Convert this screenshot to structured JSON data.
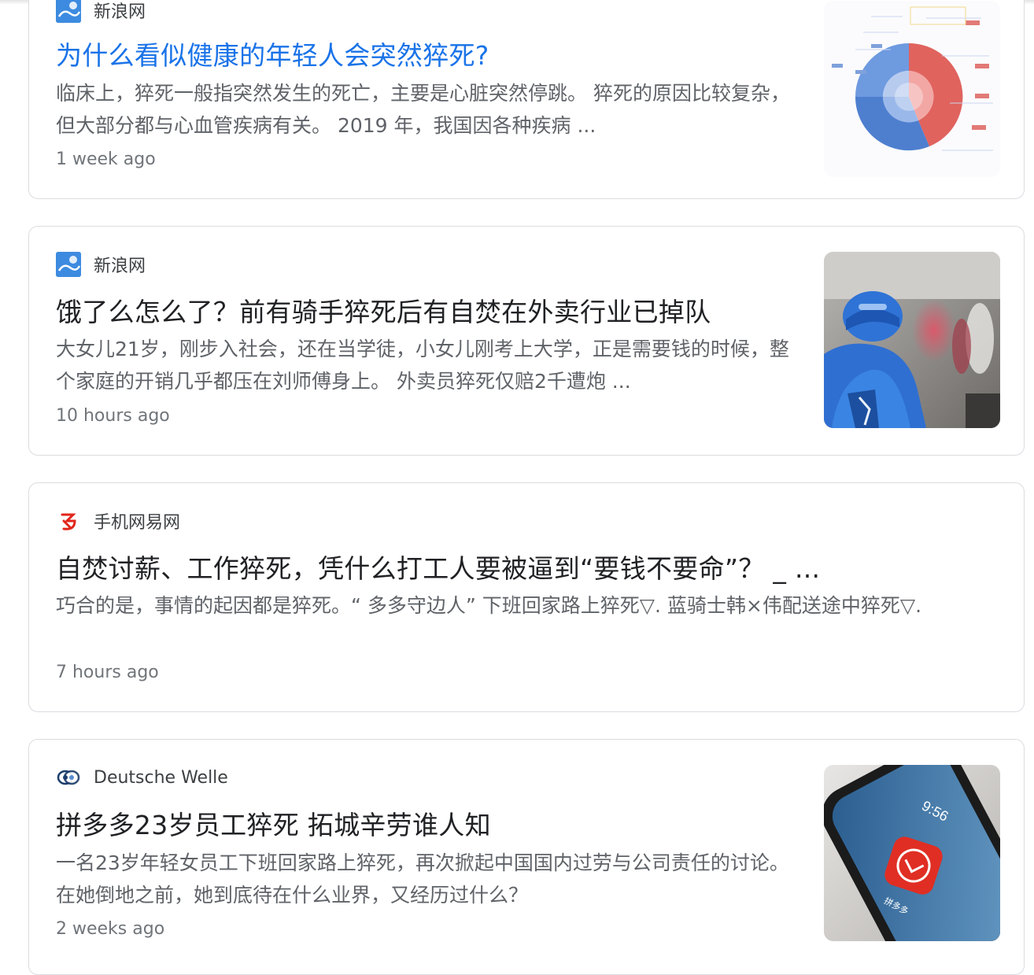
{
  "results": [
    {
      "source": "新浪网",
      "title": "为什么看似健康的年轻人会突然猝死?",
      "snippet": "临床上，猝死一般指突然发生的死亡，主要是心脏突然停跳。 猝死的原因比较复杂，但大部分都与心血管疾病有关。 2019 年，我国因各种疾病 ...",
      "time": "1 week ago"
    },
    {
      "source": "新浪网",
      "title": "饿了么怎么了？前有骑手猝死后有自焚在外卖行业已掉队",
      "snippet": "大女儿21岁，刚步入社会，还在当学徒，小女儿刚考上大学，正是需要钱的时候，整个家庭的开销几乎都压在刘师傅身上。 外卖员猝死仅赔2千遭炮 ...",
      "time": "10 hours ago"
    },
    {
      "source": "手机网易网",
      "title": "自焚讨薪、工作猝死，凭什么打工人要被逼到“要钱不要命”？ _ ...",
      "snippet": "巧合的是，事情的起因都是猝死。“ 多多守边人” 下班回家路上猝死▽. 蓝骑士韩×伟配送途中猝死▽.",
      "time": "7 hours ago"
    },
    {
      "source": "Deutsche Welle",
      "title": "拼多多23岁员工猝死 拓城辛劳谁人知",
      "snippet": "一名23岁年轻女员工下班回家路上猝死，再次掀起中国国内过劳与公司责任的讨论。在她倒地之前，她到底待在什么业界，又经历过什么？",
      "time": "2 weeks ago"
    }
  ],
  "thumbnail_text": {
    "phone_time": "9:56",
    "app_label": "拼多多"
  },
  "colors": {
    "link_blue": "#1a73e8",
    "title_dark": "#202124",
    "snippet_gray": "#5f6368",
    "time_gray": "#70757a",
    "card_border": "#dadce0"
  },
  "icons": {
    "sina": "sina-logo-icon",
    "netease": "netease-logo-icon",
    "dw": "dw-logo-icon"
  }
}
